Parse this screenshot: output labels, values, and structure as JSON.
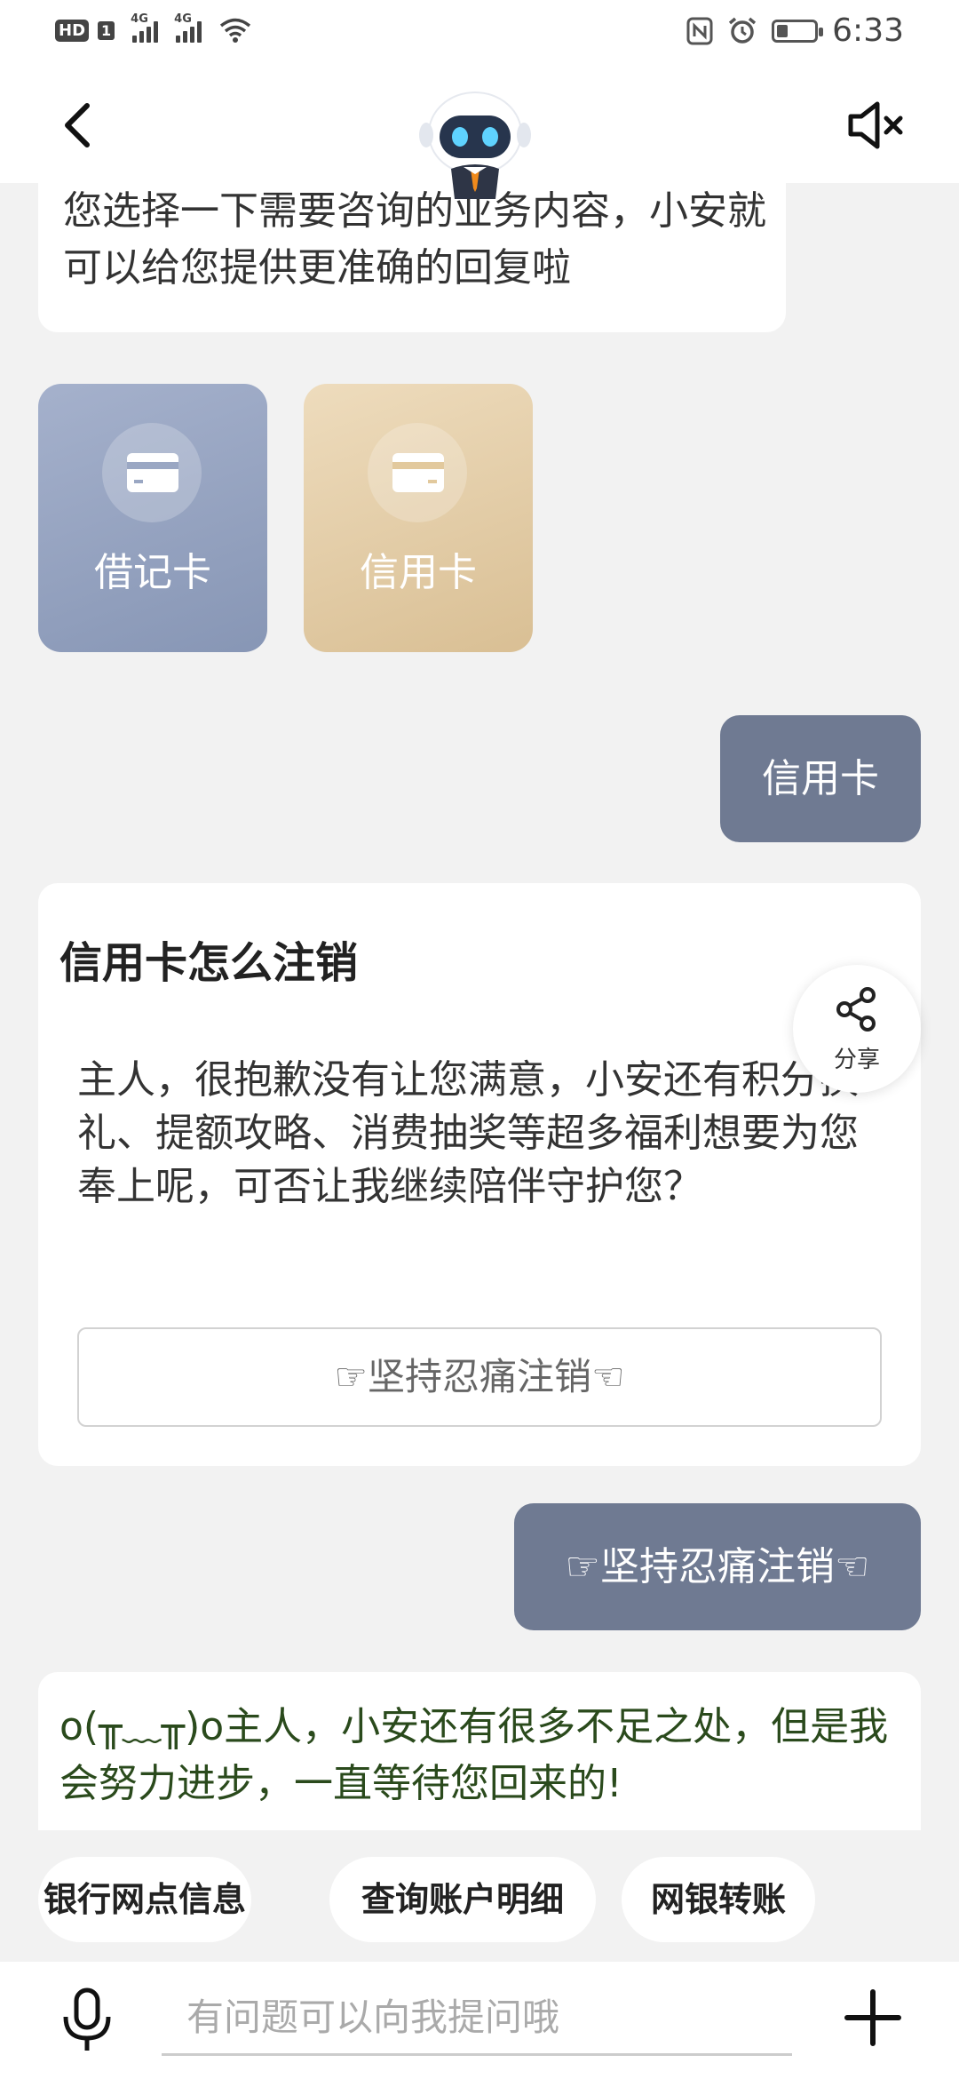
{
  "status_bar": {
    "hd": "HD",
    "sim": "1",
    "net1": "4G",
    "net2": "4G",
    "time": "6:33"
  },
  "header": {
    "back_icon": "chevron-left-icon",
    "mute_icon": "speaker-mute-icon",
    "avatar": "robot-avatar"
  },
  "messages": {
    "bot_intro": "您选择一下需要咨询的业务内容，小安就可以给您提供更准确的回复啦",
    "options": [
      {
        "label": "借记卡",
        "icon": "card-icon",
        "color": "#9aa7c3"
      },
      {
        "label": "信用卡",
        "icon": "card-icon",
        "color": "#e5cfa9"
      }
    ],
    "user_choice": "信用卡",
    "answer_card": {
      "title": "信用卡怎么注销",
      "text": "主人，很抱歉没有让您满意，小安还有积分换礼、提额攻略、消费抽奖等超多福利想要为您奉上呢，可否让我继续陪伴守护您？",
      "button": "☞坚持忍痛注销☜"
    },
    "user_reply": "☞坚持忍痛注销☜",
    "bot_last": "o(╥﹏╥)o主人，小安还有很多不足之处，但是我会努力进步，一直等待您回来的!"
  },
  "share": {
    "label": "分享",
    "icon": "share-icon"
  },
  "quick_replies": [
    "银行网点信息",
    "查询账户明细",
    "网银转账"
  ],
  "input": {
    "placeholder": "有问题可以向我提问哦",
    "value": "",
    "mic_icon": "microphone-icon",
    "plus_icon": "plus-icon"
  },
  "colors": {
    "user_bubble": "#6f7a92",
    "background": "#f2f2f2",
    "bot_last_text": "#2a4a1c"
  }
}
